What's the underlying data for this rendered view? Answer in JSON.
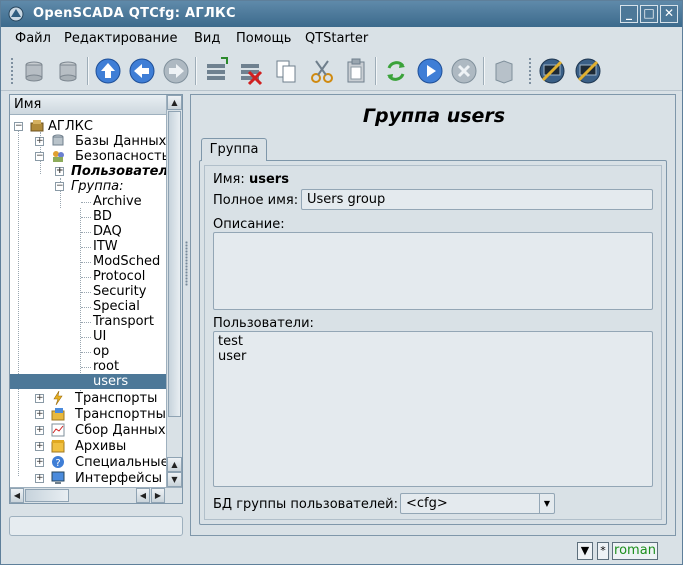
{
  "window": {
    "title": "OpenSCADA QTCfg: АГЛКС",
    "min": "_",
    "max": "□",
    "close": "✕"
  },
  "menubar": [
    {
      "label": "Файл"
    },
    {
      "label": "Редактирование"
    },
    {
      "label": "Вид"
    },
    {
      "label": "Помощь"
    },
    {
      "label": "QTStarter"
    }
  ],
  "tree": {
    "header": "Имя",
    "nodes": [
      {
        "label": "АГЛКС"
      },
      {
        "label": "Базы Данных"
      },
      {
        "label": "Безопасность"
      },
      {
        "label": "Пользователь"
      },
      {
        "label": "Группа:"
      },
      {
        "label": "Archive"
      },
      {
        "label": "BD"
      },
      {
        "label": "DAQ"
      },
      {
        "label": "ITW"
      },
      {
        "label": "ModSched"
      },
      {
        "label": "Protocol"
      },
      {
        "label": "Security"
      },
      {
        "label": "Special"
      },
      {
        "label": "Transport"
      },
      {
        "label": "UI"
      },
      {
        "label": "op"
      },
      {
        "label": "root"
      },
      {
        "label": "users"
      },
      {
        "label": "Транспорты"
      },
      {
        "label": "Транспортны"
      },
      {
        "label": "Сбор Данных"
      },
      {
        "label": "Архивы"
      },
      {
        "label": "Специальные"
      },
      {
        "label": "Интерфейсы"
      }
    ]
  },
  "page": {
    "title": "Группа users",
    "tab": "Группа",
    "name_label": "Имя:",
    "name_value": "users",
    "fullname_label": "Полное имя:",
    "fullname_value": "Users group",
    "desc_label": "Описание:",
    "desc_value": "",
    "users_label": "Пользователи:",
    "users_list": [
      "test",
      "user"
    ],
    "db_label": "БД группы пользователей:",
    "db_value": "<cfg>"
  },
  "statusbar": {
    "star": "*",
    "user": "roman"
  },
  "colors": {
    "titlebar": "#4d7898",
    "selection": "#4d7898",
    "user_text": "#1c8f1c"
  }
}
